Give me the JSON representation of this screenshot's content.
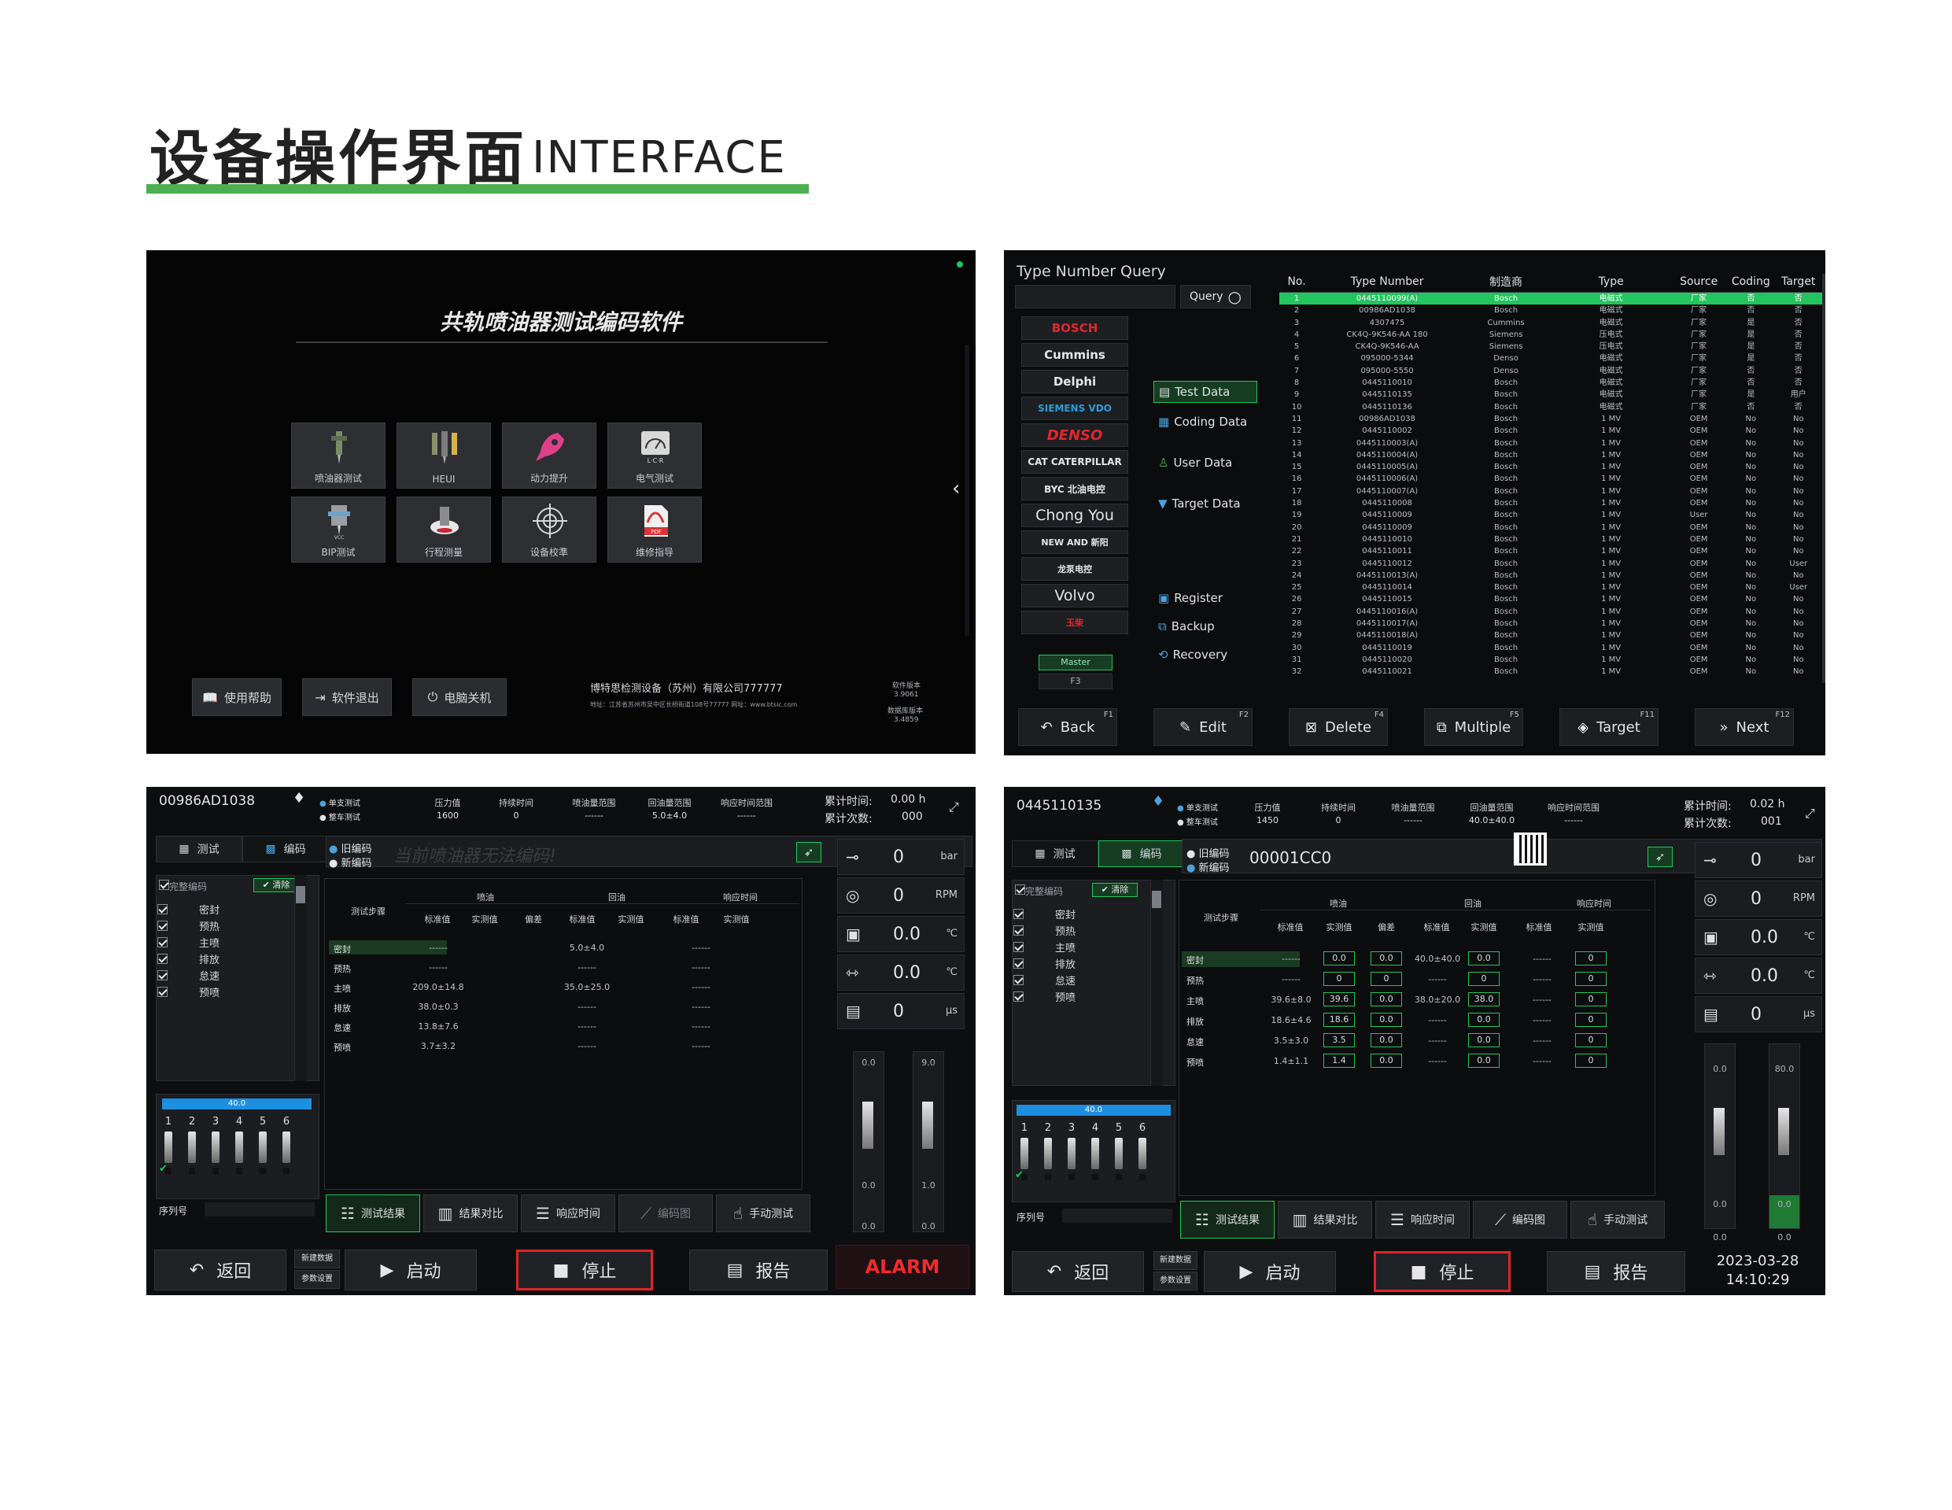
{
  "header": {
    "title": "设备操作界面",
    "subtitle": "INTERFACE",
    "accent": "#4caf50"
  },
  "panel1": {
    "title": "共轨喷油器测试编码软件",
    "tiles": [
      {
        "label": "喷油器测试",
        "icon": "injector-icon"
      },
      {
        "label": "HEUI",
        "icon": "heui-icon"
      },
      {
        "label": "动力提升",
        "icon": "rocket-icon"
      },
      {
        "label": "电气测试",
        "icon": "meter-icon"
      },
      {
        "label": "BIP测试",
        "icon": "bip-icon"
      },
      {
        "label": "行程测量",
        "icon": "stroke-icon"
      },
      {
        "label": "设备校準",
        "icon": "calibrate-icon"
      },
      {
        "label": "维修指导",
        "icon": "pdf-icon"
      }
    ],
    "buttons": {
      "help": "使用帮助",
      "exit": "软件退出",
      "shutdown": "电脑关机"
    },
    "company": "博特思检测设备（苏州）有限公司777777",
    "address": "地址：江苏省苏州市吴中区长桥街道108号77777  网址：www.btsic.com",
    "software_version_label": "软件版本",
    "software_version": "3.9061",
    "db_version_label": "数据库版本",
    "db_version": "3.4859"
  },
  "panel2": {
    "query_label": "Type Number Query",
    "query_button": "Query",
    "brands": [
      "BOSCH",
      "Cummins",
      "Delphi",
      "SIEMENS VDO",
      "DENSO",
      "CAT CATERPILLAR",
      "BYC 北油电控",
      "Chong You",
      "NEW AND 新阳",
      "龙泵电控",
      "Volvo",
      "玉柴"
    ],
    "side_buttons": [
      "Test Data",
      "Coding Data",
      "User Data",
      "Target Data",
      "Register",
      "Backup",
      "Recovery"
    ],
    "master_label": "Master",
    "f3_label": "F3",
    "columns": [
      "No.",
      "Type Number",
      "制造商",
      "Type",
      "Source",
      "Coding",
      "Target"
    ],
    "rows": [
      [
        "1",
        "0445110099(A)",
        "Bosch",
        "电磁式",
        "厂家",
        "否",
        "否"
      ],
      [
        "2",
        "00986AD1038",
        "Bosch",
        "电磁式",
        "厂家",
        "否",
        "否"
      ],
      [
        "3",
        "4307475",
        "Cummins",
        "电磁式",
        "厂家",
        "是",
        "否"
      ],
      [
        "4",
        "CK4Q-9K546-AA 180",
        "Siemens",
        "压电式",
        "厂家",
        "是",
        "否"
      ],
      [
        "5",
        "CK4Q-9K546-AA",
        "Siemens",
        "压电式",
        "厂家",
        "是",
        "否"
      ],
      [
        "6",
        "095000-5344",
        "Denso",
        "电磁式",
        "厂家",
        "是",
        "否"
      ],
      [
        "7",
        "095000-5550",
        "Denso",
        "电磁式",
        "厂家",
        "否",
        "否"
      ],
      [
        "8",
        "0445110010",
        "Bosch",
        "电磁式",
        "厂家",
        "否",
        "否"
      ],
      [
        "9",
        "0445110135",
        "Bosch",
        "电磁式",
        "厂家",
        "是",
        "用户"
      ],
      [
        "10",
        "0445110136",
        "Bosch",
        "电磁式",
        "厂家",
        "否",
        "否"
      ],
      [
        "11",
        "00986AD1038",
        "Bosch",
        "1 MV",
        "OEM",
        "No",
        "No"
      ],
      [
        "12",
        "0445110002",
        "Bosch",
        "1 MV",
        "OEM",
        "No",
        "No"
      ],
      [
        "13",
        "0445110003(A)",
        "Bosch",
        "1 MV",
        "OEM",
        "No",
        "No"
      ],
      [
        "14",
        "0445110004(A)",
        "Bosch",
        "1 MV",
        "OEM",
        "No",
        "No"
      ],
      [
        "15",
        "0445110005(A)",
        "Bosch",
        "1 MV",
        "OEM",
        "No",
        "No"
      ],
      [
        "16",
        "0445110006(A)",
        "Bosch",
        "1 MV",
        "OEM",
        "No",
        "No"
      ],
      [
        "17",
        "0445110007(A)",
        "Bosch",
        "1 MV",
        "OEM",
        "No",
        "No"
      ],
      [
        "18",
        "0445110008",
        "Bosch",
        "1 MV",
        "OEM",
        "No",
        "No"
      ],
      [
        "19",
        "0445110009",
        "Bosch",
        "1 MV",
        "User",
        "No",
        "No"
      ],
      [
        "20",
        "0445110009",
        "Bosch",
        "1 MV",
        "OEM",
        "No",
        "No"
      ],
      [
        "21",
        "0445110010",
        "Bosch",
        "1 MV",
        "OEM",
        "No",
        "No"
      ],
      [
        "22",
        "0445110011",
        "Bosch",
        "1 MV",
        "OEM",
        "No",
        "No"
      ],
      [
        "23",
        "0445110012",
        "Bosch",
        "1 MV",
        "OEM",
        "No",
        "User"
      ],
      [
        "24",
        "0445110013(A)",
        "Bosch",
        "1 MV",
        "OEM",
        "No",
        "No"
      ],
      [
        "25",
        "0445110014",
        "Bosch",
        "1 MV",
        "OEM",
        "No",
        "User"
      ],
      [
        "26",
        "0445110015",
        "Bosch",
        "1 MV",
        "OEM",
        "No",
        "No"
      ],
      [
        "27",
        "0445110016(A)",
        "Bosch",
        "1 MV",
        "OEM",
        "No",
        "No"
      ],
      [
        "28",
        "0445110017(A)",
        "Bosch",
        "1 MV",
        "OEM",
        "No",
        "No"
      ],
      [
        "29",
        "0445110018(A)",
        "Bosch",
        "1 MV",
        "OEM",
        "No",
        "No"
      ],
      [
        "30",
        "0445110019",
        "Bosch",
        "1 MV",
        "OEM",
        "No",
        "No"
      ],
      [
        "31",
        "0445110020",
        "Bosch",
        "1 MV",
        "OEM",
        "No",
        "No"
      ],
      [
        "32",
        "0445110021",
        "Bosch",
        "1 MV",
        "OEM",
        "No",
        "No"
      ]
    ],
    "bottom": [
      {
        "label": "Back",
        "key": "F1",
        "icon": "back-arrow-icon"
      },
      {
        "label": "Edit",
        "key": "F2",
        "icon": "edit-icon"
      },
      {
        "label": "Delete",
        "key": "F4",
        "icon": "delete-icon"
      },
      {
        "label": "Multiple",
        "key": "F5",
        "icon": "multiple-icon"
      },
      {
        "label": "Target",
        "key": "F11",
        "icon": "target-icon"
      },
      {
        "label": "Next",
        "key": "F12",
        "icon": "next-icon"
      }
    ]
  },
  "panel3": {
    "type_number": "00986AD1038",
    "mode_single": "单支测试",
    "mode_multi": "整车测试",
    "params": [
      {
        "label": "压力值",
        "value": "1600"
      },
      {
        "label": "持续时间",
        "value": "0"
      },
      {
        "label": "喷油量范围",
        "value": "------"
      },
      {
        "label": "回油量范围",
        "value": "5.0±4.0"
      },
      {
        "label": "响应时间范围",
        "value": "------"
      }
    ],
    "cum_time_label": "累计时间:",
    "cum_time": "0.00 h",
    "cum_count_label": "累计次数:",
    "cum_count": "000",
    "tab_test": "测试",
    "tab_code": "编码",
    "old_code": "旧编码",
    "new_code": "新编码",
    "code_message": "当前喷油器无法编码!",
    "full_code_label": "完整编码",
    "clear_label": "清除",
    "steps": [
      "密封",
      "预热",
      "主喷",
      "排放",
      "怠速",
      "预喷"
    ],
    "grid_groups": [
      "喷油",
      "回油",
      "响应时间"
    ],
    "grid_sub": [
      "标准值",
      "实测值",
      "偏差",
      "标准值",
      "实测值",
      "标准值",
      "实测值"
    ],
    "grid_step_label": "测试步骤",
    "grid_rows": [
      {
        "step": "密封",
        "std1": "------",
        "std2": "5.0±4.0",
        "std3": "------"
      },
      {
        "step": "预热",
        "std1": "------",
        "std2": "------",
        "std3": "------"
      },
      {
        "step": "主喷",
        "std1": "209.0±14.8",
        "std2": "35.0±25.0",
        "std3": "------"
      },
      {
        "step": "排放",
        "std1": "38.0±0.3",
        "std2": "------",
        "std3": "------"
      },
      {
        "step": "怠速",
        "std1": "13.8±7.6",
        "std2": "------",
        "std3": "------"
      },
      {
        "step": "预喷",
        "std1": "3.7±3.2",
        "std2": "------",
        "std3": "------"
      }
    ],
    "progress": "40.0",
    "cyl": [
      "1",
      "2",
      "3",
      "4",
      "5",
      "6"
    ],
    "serial_label": "序列号",
    "gauges": [
      {
        "value": "0",
        "unit": "bar",
        "icon": "pressure-icon"
      },
      {
        "value": "0",
        "unit": "RPM",
        "icon": "rpm-icon"
      },
      {
        "value": "0.0",
        "unit": "℃",
        "icon": "temp-icon"
      },
      {
        "value": "0.0",
        "unit": "℃",
        "icon": "oil-temp-icon"
      },
      {
        "value": "0",
        "unit": "μs",
        "icon": "response-icon"
      }
    ],
    "bars": [
      {
        "top": "0.0",
        "bottom": "0.0"
      },
      {
        "top": "9.0",
        "bottom": "1.0"
      }
    ],
    "bar_foot": [
      "0.0",
      "0.0"
    ],
    "tabs": [
      "测试结果",
      "结果对比",
      "响应时间",
      "编码图",
      "手动测试"
    ],
    "new_data": "新建数据",
    "param_set": "参数设置",
    "btn_back": "返回",
    "btn_start": "启动",
    "btn_stop": "停止",
    "btn_report": "报告",
    "alarm": "ALARM"
  },
  "panel4": {
    "type_number": "0445110135",
    "mode_single": "单支测试",
    "mode_multi": "整车测试",
    "params": [
      {
        "label": "压力值",
        "value": "1450"
      },
      {
        "label": "持续时间",
        "value": "0"
      },
      {
        "label": "喷油量范围",
        "value": "------"
      },
      {
        "label": "回油量范围",
        "value": "40.0±40.0"
      },
      {
        "label": "响应时间范围",
        "value": "------"
      }
    ],
    "cum_time_label": "累计时间:",
    "cum_time": "0.02 h",
    "cum_count_label": "累计次数:",
    "cum_count": "001",
    "tab_test": "测试",
    "tab_code": "编码",
    "old_code": "旧编码",
    "new_code": "新编码",
    "code_value": "00001CC0",
    "full_code_label": "完整编码",
    "clear_label": "清除",
    "steps": [
      "密封",
      "预热",
      "主喷",
      "排放",
      "怠速",
      "预喷"
    ],
    "grid_rows": [
      {
        "step": "密封",
        "std1": "------",
        "m1": "0.0",
        "dev": "0.0",
        "std2": "40.0±40.0",
        "m2": "0.0",
        "std3": "------",
        "m3": "0"
      },
      {
        "step": "预热",
        "std1": "------",
        "m1": "0",
        "dev": "0",
        "std2": "------",
        "m2": "0",
        "std3": "------",
        "m3": "0"
      },
      {
        "step": "主喷",
        "std1": "39.6±8.0",
        "m1": "39.6",
        "dev": "0.0",
        "std2": "38.0±20.0",
        "m2": "38.0",
        "std3": "------",
        "m3": "0"
      },
      {
        "step": "排放",
        "std1": "18.6±4.6",
        "m1": "18.6",
        "dev": "0.0",
        "std2": "------",
        "m2": "0.0",
        "std3": "------",
        "m3": "0"
      },
      {
        "step": "怠速",
        "std1": "3.5±3.0",
        "m1": "3.5",
        "dev": "0.0",
        "std2": "------",
        "m2": "0.0",
        "std3": "------",
        "m3": "0"
      },
      {
        "step": "预喷",
        "std1": "1.4±1.1",
        "m1": "1.4",
        "dev": "0.0",
        "std2": "------",
        "m2": "0.0",
        "std3": "------",
        "m3": "0"
      }
    ],
    "progress": "40.0",
    "gauges": [
      {
        "value": "0",
        "unit": "bar"
      },
      {
        "value": "0",
        "unit": "RPM"
      },
      {
        "value": "0.0",
        "unit": "℃"
      },
      {
        "value": "0.0",
        "unit": "℃"
      },
      {
        "value": "0",
        "unit": "μs"
      }
    ],
    "bars": [
      {
        "top": "0.0",
        "bottom": "0.0"
      },
      {
        "top": "80.0",
        "bottom": "0.0"
      }
    ],
    "bar_foot": [
      "0.0",
      "0.0"
    ],
    "datetime_date": "2023-03-28",
    "datetime_time": "14:10:29"
  }
}
